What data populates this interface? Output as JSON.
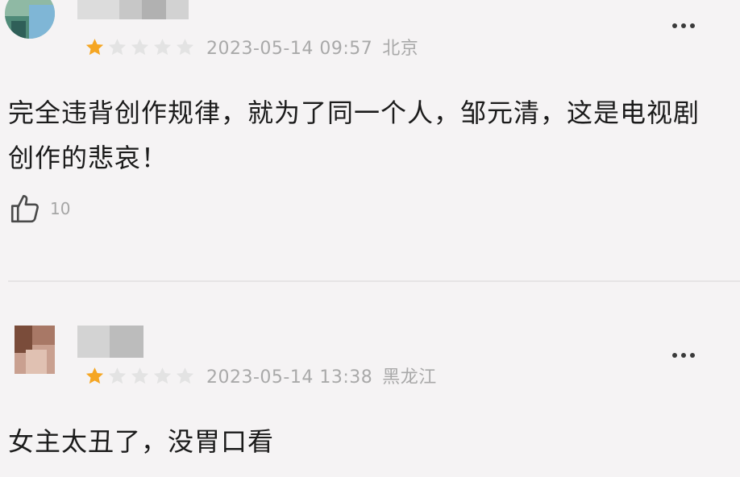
{
  "comments": [
    {
      "rating": 1,
      "max_rating": 5,
      "datetime": "2023-05-14 09:57",
      "location": "北京",
      "text": "完全违背创作规律，就为了同一个人，邹元清，这是电视剧创作的悲哀！",
      "likes": "10"
    },
    {
      "rating": 1,
      "max_rating": 5,
      "datetime": "2023-05-14 13:38",
      "location": "黑龙江",
      "text": "女主太丑了，没胃口看"
    }
  ],
  "icons": {
    "star_filled": "star-filled-icon",
    "star_empty": "star-empty-icon",
    "more": "more-options-icon",
    "like": "thumbs-up-icon"
  },
  "colors": {
    "star_filled": "#f5a623",
    "star_empty": "#e3e3e3",
    "meta": "#a9a9a9",
    "background": "#f5f3f4"
  }
}
